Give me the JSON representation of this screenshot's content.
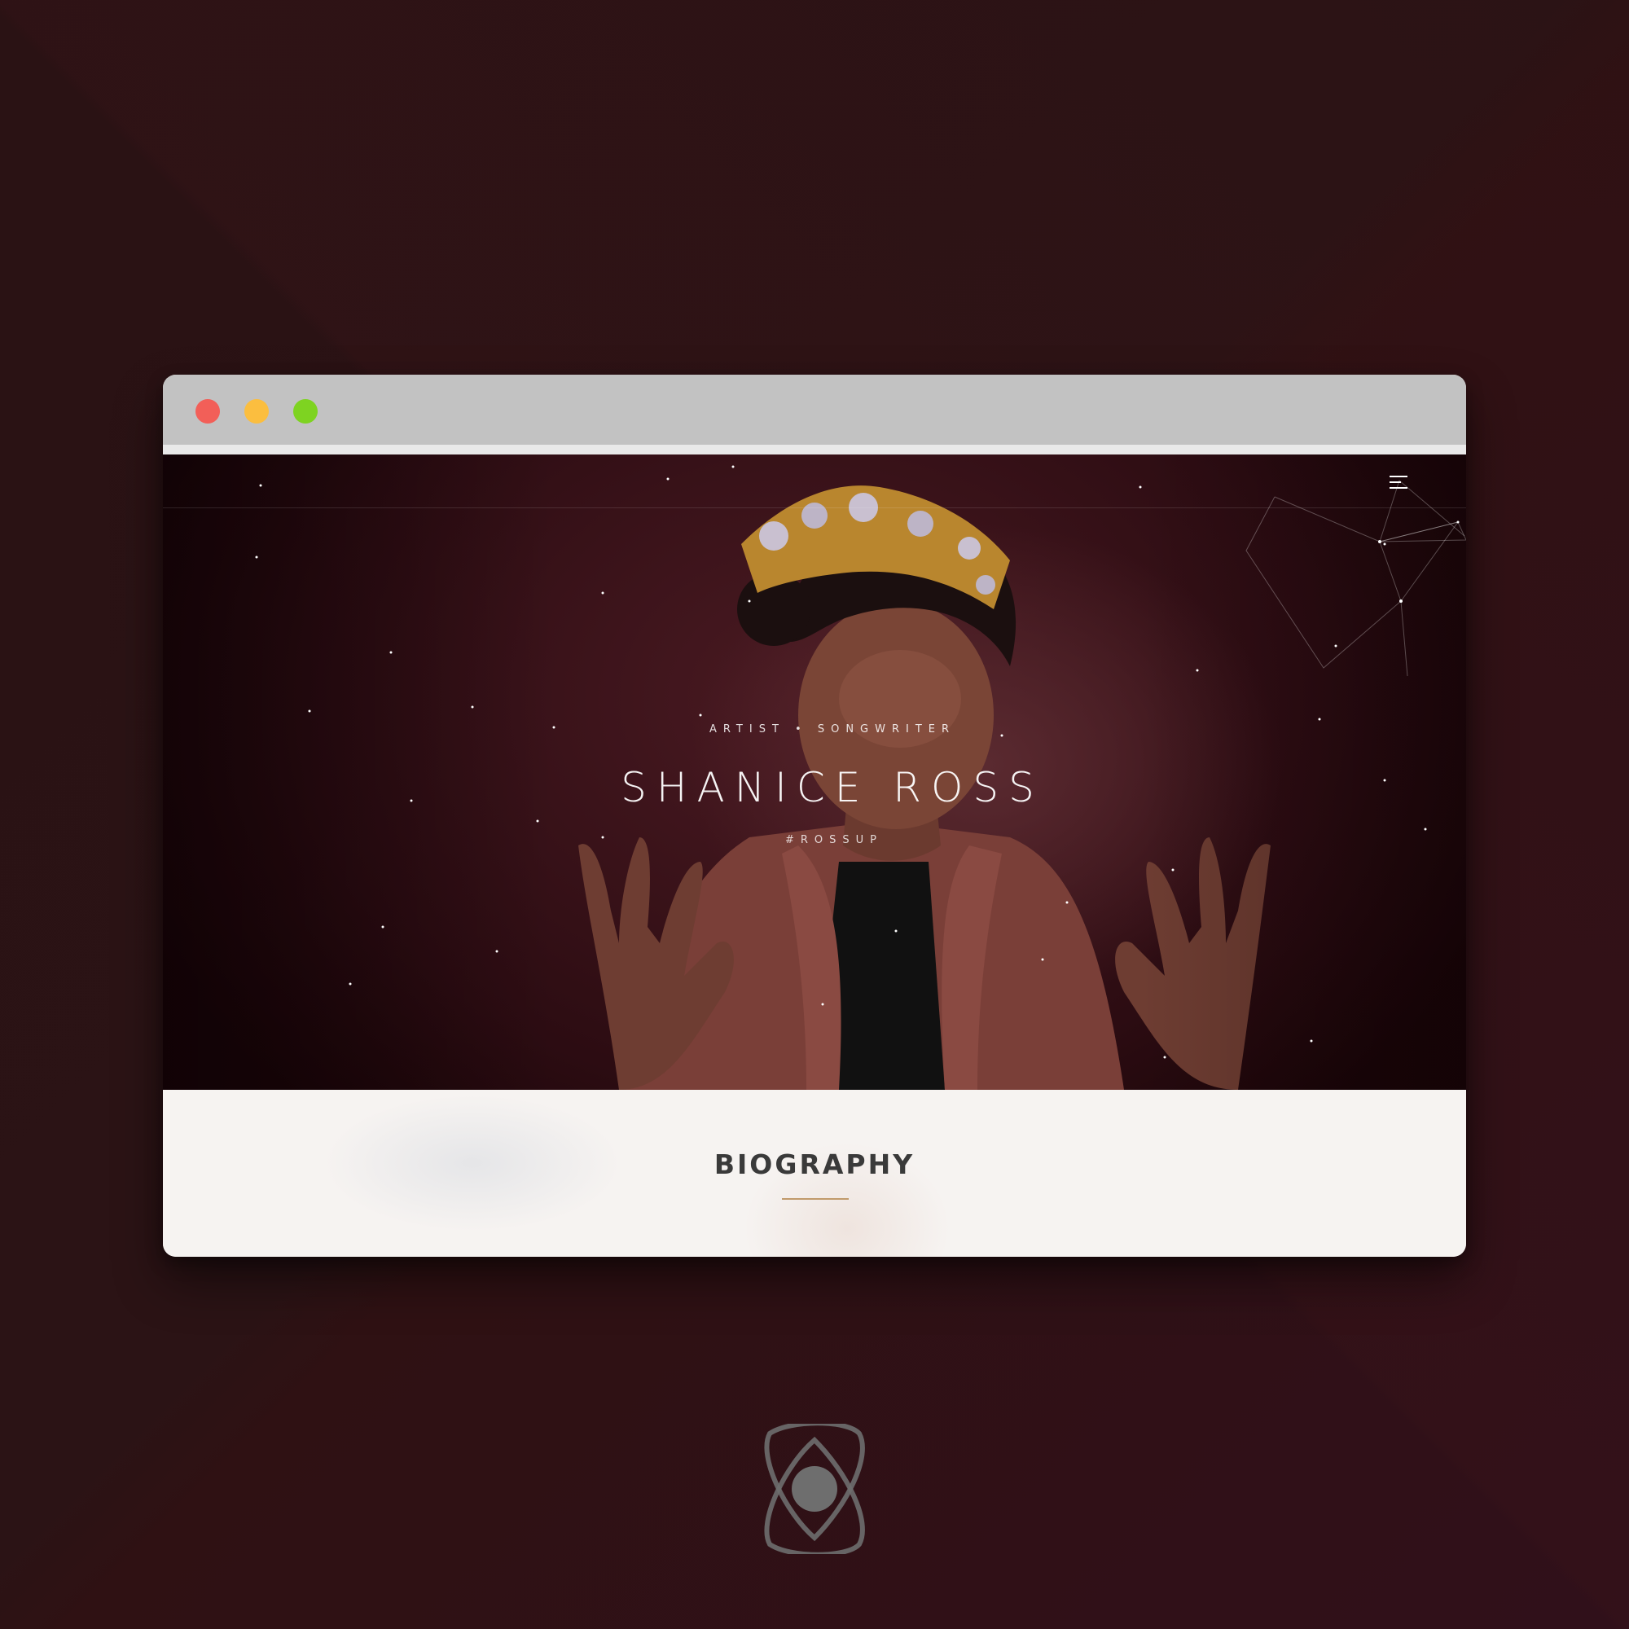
{
  "window": {
    "controls": {
      "close_color": "#f25f58",
      "minimize_color": "#fbbe3f",
      "maximize_color": "#7ed321"
    }
  },
  "hero": {
    "subtitle": "ARTIST • SONGWRITER",
    "title": "SHANICE ROSS",
    "tagline": "#ROSSUP",
    "menu_icon": "hamburger-menu-icon"
  },
  "biography": {
    "heading": "BIOGRAPHY",
    "accent_color": "#c19a6b"
  },
  "footer": {
    "logo_icon": "atom-logo-icon"
  },
  "colors": {
    "page_background": "#2b1315",
    "titlebar": "#c2c2c2",
    "hero_background": "#3a1218"
  }
}
